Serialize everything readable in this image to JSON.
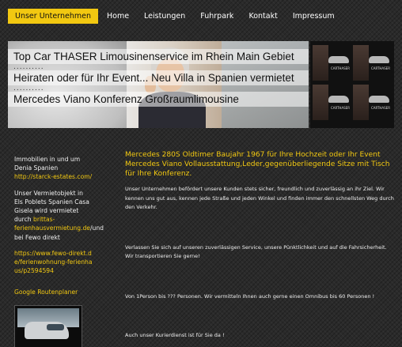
{
  "nav": {
    "items": [
      {
        "label": "Unser Unternehmen",
        "active": true
      },
      {
        "label": "Home"
      },
      {
        "label": "Leistungen"
      },
      {
        "label": "Fuhrpark"
      },
      {
        "label": "Kontakt"
      },
      {
        "label": "Impressum"
      }
    ],
    "active_color": "#f2c811"
  },
  "banner": {
    "lines": [
      "Top Car THASER   Limousinenservice im Rhein Main Gebiet",
      "Heiraten oder für Ihr Event...  Neu Villa in Spanien vermietet",
      "Mercedes Viano  Konferenz Großraumlimousine"
    ],
    "dots": "..........",
    "thumb_brand": "CARTHASER"
  },
  "sidebar": {
    "p1": "Immobilien in und um Denia Spanien",
    "p1_link": "http://starck-estates.com/",
    "p2_pre": "Unser Vermietobjekt in Els Poblets Spanien  Casa Gisela wird vermietet durch ",
    "p2_link": "brittas-ferienhausvermietung.de",
    "p2_post": "/und bei Fewo direkt",
    "p3_link": "https://www.fewo-direkt.de/ferienwohnung-ferienhaus/p2594594",
    "routenplaner": "Google Routenplaner"
  },
  "main": {
    "title": "Mercedes 280S Oldtimer Baujahr 1967 für Ihre Hochzeit oder Ihr Event Mercedes Viano Vollausstattung,Leder,gegenüberliegende Sitze mit Tisch für Ihre Konferenz.",
    "para1": "Unser Unternehmen befördert unsere Kunden stets sicher, freundlich und zuverlässig an ihr Ziel. Wir kennen uns gut aus, kennen jede Straße und jeden Winkel und finden immer den schnellsten Weg durch den Verkehr.",
    "para2": "Verlassen Sie sich auf unseren zuverlässigen Service, unsere Pünktlichkeit und auf die Fahrsicherheit. Wir transportieren Sie gerne!",
    "para3": "Von 1Person bis ??? Personen. Wir vermitteln Ihnen auch gerne einen Omnibus bis 60 Personen !",
    "para4": "Auch unser Kurierdienst ist für Sie da !"
  }
}
